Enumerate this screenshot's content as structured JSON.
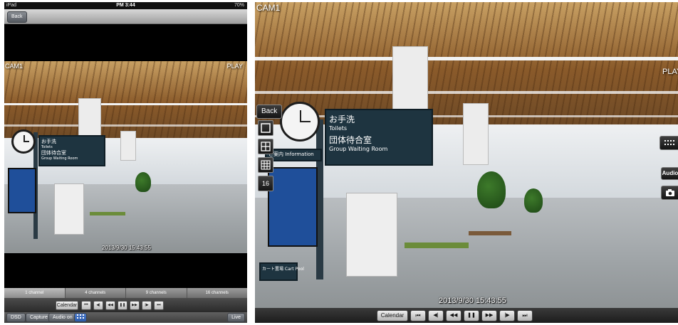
{
  "left": {
    "status_bar": {
      "carrier": "iPad",
      "time": "PM 3:44",
      "battery": "70%"
    },
    "back_label": "Back",
    "camera_label": "CAM1",
    "play_label": "PLAY",
    "timestamp": "2013/9/30 15:43:55",
    "tabs": [
      {
        "label": "1 channel",
        "active": true
      },
      {
        "label": "4 channels",
        "active": false
      },
      {
        "label": "9 channels",
        "active": false
      },
      {
        "label": "16 channels",
        "active": false
      }
    ],
    "controls": {
      "calendar_label": "Calendar",
      "buttons": [
        "skip-start",
        "step-back",
        "rewind",
        "pause",
        "fast-forward",
        "step-forward",
        "skip-end"
      ],
      "glyphs": [
        "⏮",
        "◀|",
        "◀◀",
        "❚❚",
        "▶▶",
        "|▶",
        "⏭"
      ]
    },
    "bottom": {
      "dsd_label": "DSD",
      "capture_label": "Capture",
      "audio_label": "Audio on",
      "live_label": "Live"
    }
  },
  "right": {
    "camera_label": "CAM1",
    "play_label": "PLAY",
    "back_label": "Back",
    "timestamp": "2013/9/30 15:43:55",
    "audio_label": "Audio",
    "controls": {
      "calendar_label": "Calendar",
      "glyphs": [
        "⏮",
        "◀|",
        "◀◀",
        "❚❚",
        "▶▶",
        "|▶",
        "⏭"
      ]
    },
    "layout_icons": [
      "1x1",
      "2x2",
      "3x3",
      "16"
    ]
  },
  "scene_text": {
    "sign_toilets_jp": "お手洗",
    "sign_toilets_en": "Toilets",
    "sign_waiting_jp": "団体待合室",
    "sign_waiting_en": "Group Waiting Room",
    "info_label": "ご案内 Information",
    "cart_label": "カート置場 Cart Pool"
  },
  "colors": {
    "sign_bg": "#1e3440",
    "ceiling": "#8a5a2a",
    "toolbar": "#2a2a2a"
  }
}
